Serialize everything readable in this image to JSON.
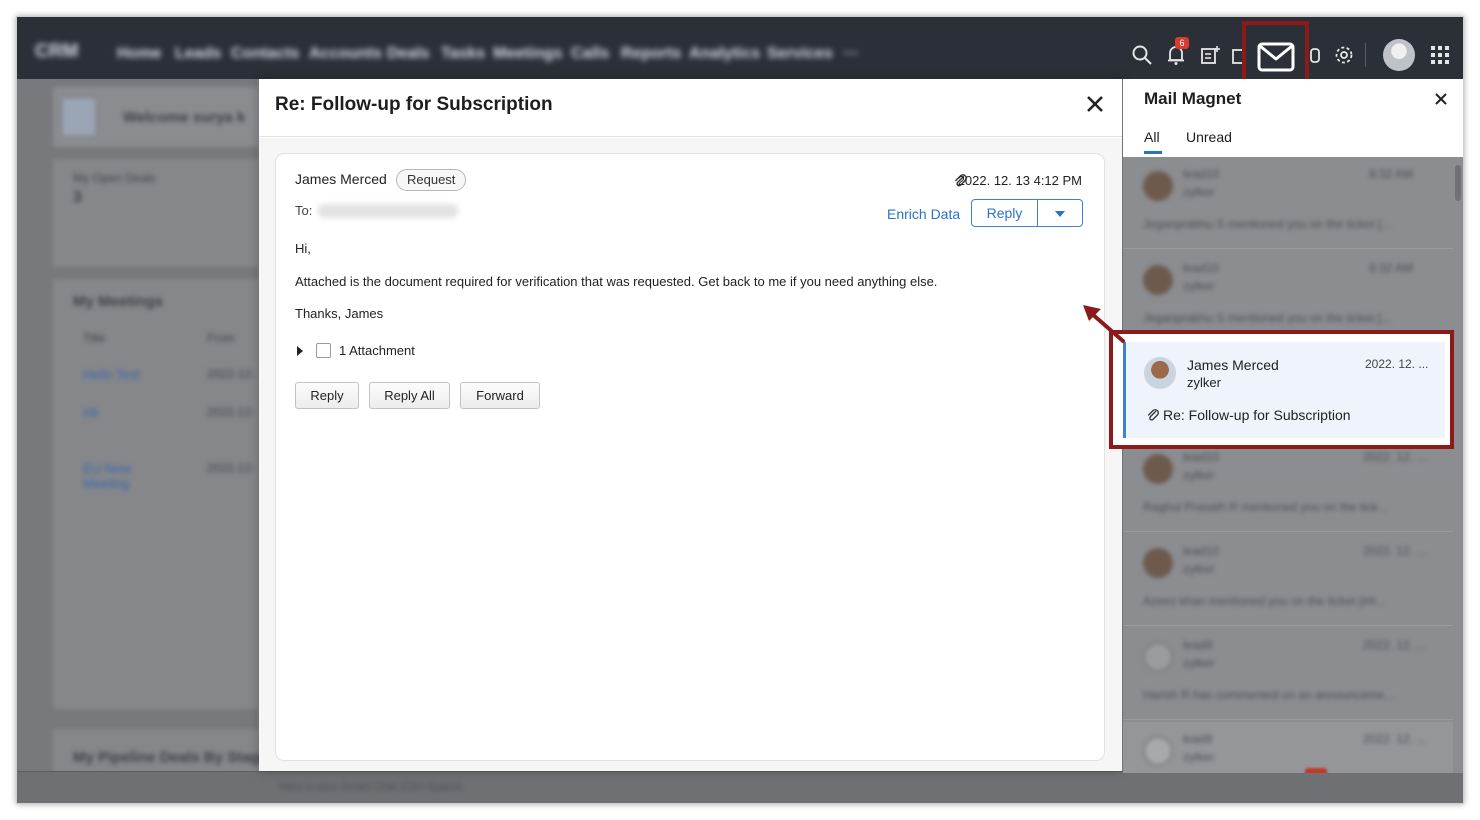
{
  "topnav": {
    "brand": "CRM",
    "tabs": [
      "Home",
      "Leads",
      "Contacts",
      "Accounts",
      "Deals",
      "Tasks",
      "Meetings",
      "Calls",
      "Reports",
      "Analytics",
      "Services",
      "···"
    ],
    "notification_count": "6"
  },
  "dashboard": {
    "welcome": "Welcome surya k",
    "open_deals_label": "My Open Deals",
    "open_deals_value": "3",
    "meetings_title": "My Meetings",
    "col_title": "Title",
    "col_from": "From",
    "rows": [
      {
        "title": "Hello Test",
        "from": "2022-12-"
      },
      {
        "title": "Hii",
        "from": "2022-12-"
      },
      {
        "title": "EU New Meeting",
        "from": "2022-12-"
      }
    ],
    "pipeline_title": "My Pipeline Deals By Stage",
    "bottom_placeholder": "Here is your Smart Chat (Ctrl+Space)"
  },
  "modal": {
    "title": "Re: Follow-up for Subscription",
    "sender": "James Merced",
    "tag": "Request",
    "to_label": "To:",
    "date": "2022. 12. 13 4:12 PM",
    "enrich_label": "Enrich Data",
    "reply_label": "Reply",
    "body_greeting": "Hi,",
    "body_text": "Attached is the document required for verification that was requested. Get back to me if you need anything else.",
    "body_signoff": "Thanks, James",
    "attachment_label": "1 Attachment",
    "actions": {
      "reply": "Reply",
      "reply_all": "Reply All",
      "forward": "Forward"
    }
  },
  "mail_magnet": {
    "title": "Mail Magnet",
    "tabs": {
      "all": "All",
      "unread": "Unread"
    },
    "items": [
      {
        "name": "lead10",
        "company": "zylker",
        "time": "8:32 AM",
        "text": "Jeganprabhu S mentioned you on the ticket [..."
      },
      {
        "name": "lead10",
        "company": "zylker",
        "time": "8:32 AM",
        "text": "Jeganprabhu S mentioned you on the ticket [..."
      },
      {
        "name": "lead10",
        "company": "zylker",
        "time": "2022. 12. ...",
        "text": "Raghul Prasath R mentioned you on the tick..."
      },
      {
        "name": "lead10",
        "company": "zylker",
        "time": "2022. 12. ...",
        "text": "Azeez khan mentioned you on the ticket [##..."
      },
      {
        "name": "lead9",
        "company": "zylker",
        "time": "2022. 12. ...",
        "text": "Harish R has commented on an announceme..."
      },
      {
        "name": "lead9",
        "company": "zylker",
        "time": "2022. 12. ...",
        "text": ""
      }
    ],
    "highlighted": {
      "name": "James Merced",
      "company": "zylker",
      "date": "2022. 12. ...",
      "subject": "Re: Follow-up for Subscription"
    }
  },
  "colors": {
    "accent": "#2a72c9",
    "highlight_border": "#8b1a1a",
    "nav_bg": "#2b2f38"
  }
}
